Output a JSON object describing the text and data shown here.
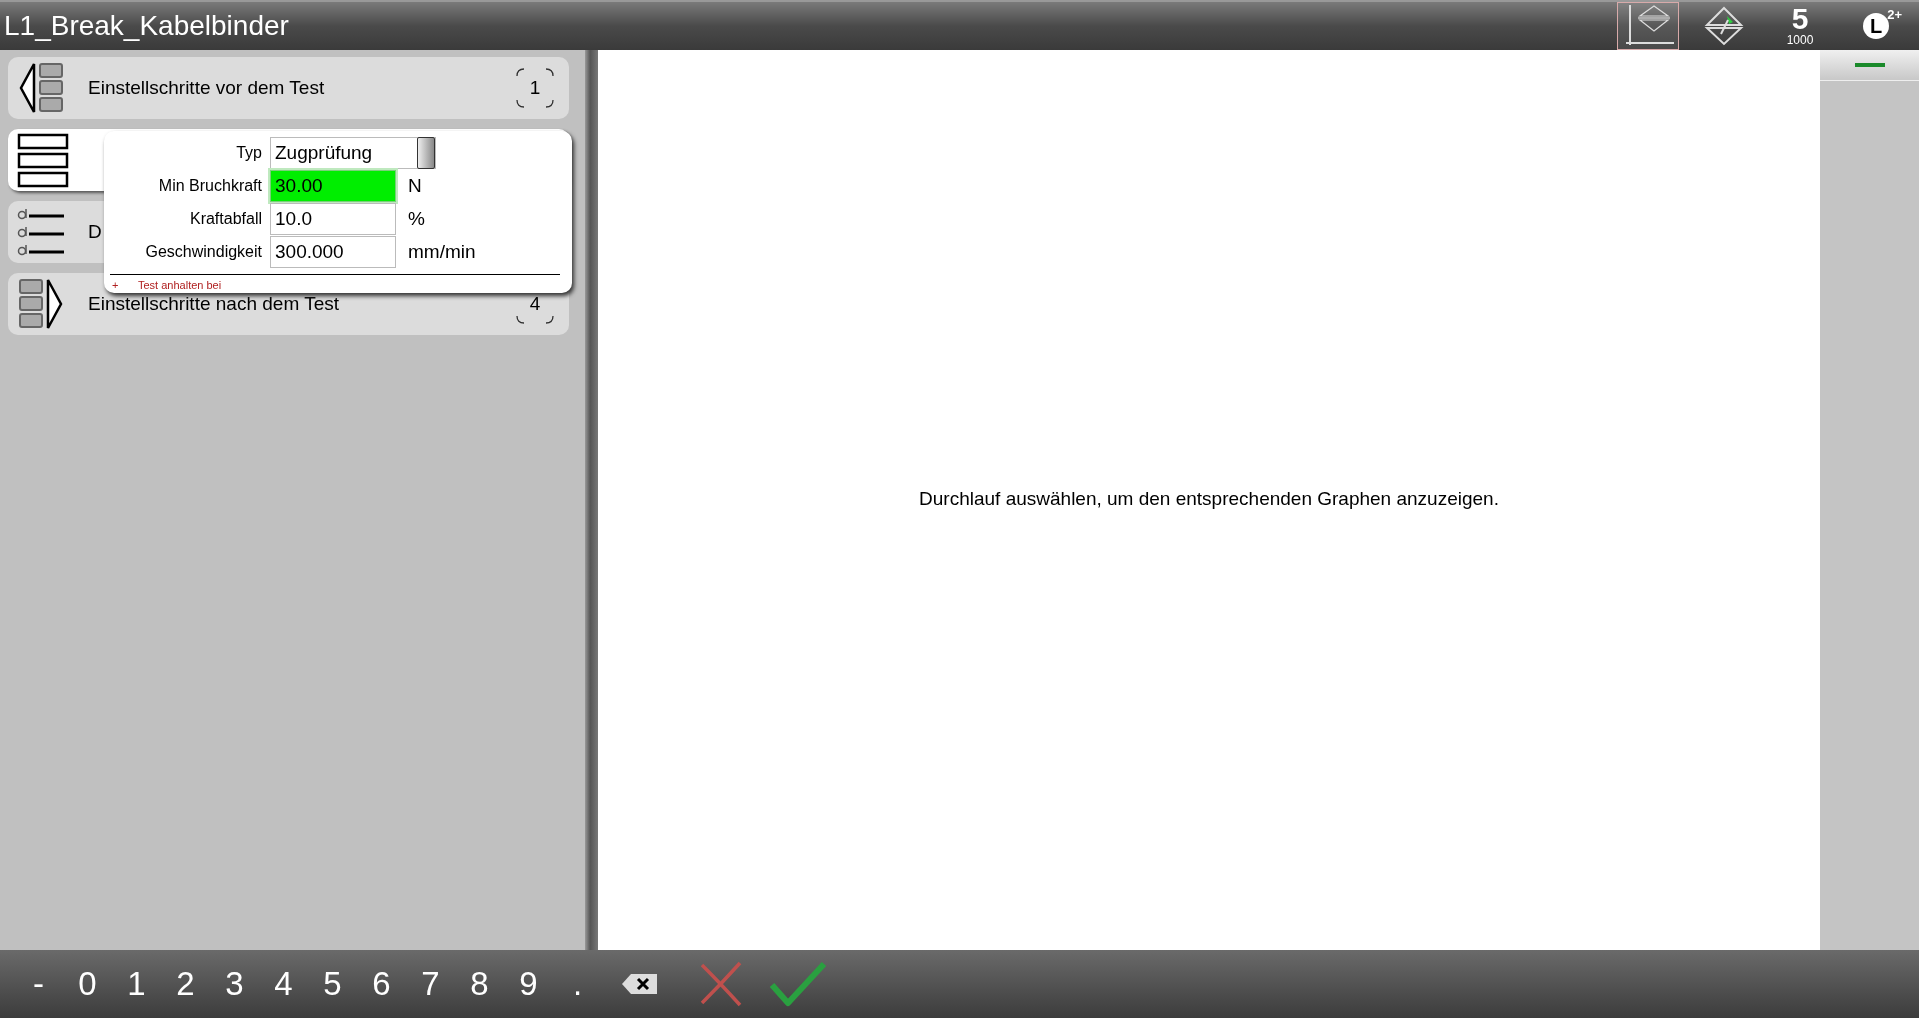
{
  "window": {
    "title": "L1_Break_Kabelbinder"
  },
  "toolbar": [
    {
      "kind": "chart",
      "selected": true
    },
    {
      "kind": "gauge",
      "selected": false
    },
    {
      "kind": "speed",
      "label": "5",
      "sublabel": "1000",
      "selected": false
    },
    {
      "kind": "user",
      "label": "L",
      "superscript": "2+",
      "selected": false
    }
  ],
  "steps": [
    {
      "kind": "before",
      "label": "Einstellschritte vor dem Test",
      "count": "1",
      "selected": false
    },
    {
      "kind": "test",
      "selected": true
    },
    {
      "kind": "data",
      "label": "D",
      "selected": false
    },
    {
      "kind": "after",
      "label": "Einstellschritte nach dem Test",
      "count": "4",
      "selected": false
    }
  ],
  "popup": {
    "fields": [
      {
        "kind": "dropdown",
        "label": "Typ",
        "value": "Zugprüfung",
        "highlighted": false
      },
      {
        "kind": "number",
        "label": "Min Bruchkraft",
        "value": "30.00",
        "unit": "N",
        "highlighted": true
      },
      {
        "kind": "number",
        "label": "Kraftabfall",
        "value": "10.0",
        "unit": "%",
        "highlighted": false
      },
      {
        "kind": "number",
        "label": "Geschwindigkeit",
        "value": "300.000",
        "unit": "mm/min",
        "highlighted": false
      }
    ],
    "section": {
      "marker": "+",
      "label": "Test anhalten bei"
    }
  },
  "graph": {
    "message": "Durchlauf auswählen, um den entsprechenden Graphen anzuzeigen."
  },
  "keypad": {
    "keys": [
      "-",
      "0",
      "1",
      "2",
      "3",
      "4",
      "5",
      "6",
      "7",
      "8",
      "9",
      "."
    ]
  }
}
